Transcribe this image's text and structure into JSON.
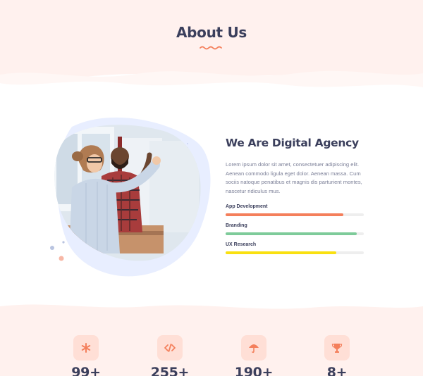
{
  "section": {
    "title": "About Us"
  },
  "about": {
    "heading": "We Are Digital Agency",
    "paragraph": "Lorem ipsum dolor sit amet, consectetuer adipiscing elit. Aenean commodo ligula eget dolor. Aenean massa. Cum sociis natoque penatibus et magnis dis parturient montes, nascetur ridiculus mus.",
    "skills": [
      {
        "label": "App Development",
        "level": 0.85,
        "color": "#f47f5b"
      },
      {
        "label": "Branding",
        "level": 0.95,
        "color": "#7ecb9a"
      },
      {
        "label": "UX Research",
        "level": 0.8,
        "color": "#f9e010"
      }
    ]
  },
  "stats": [
    {
      "icon": "asterisk-icon",
      "value": "99+"
    },
    {
      "icon": "code-icon",
      "value": "255+"
    },
    {
      "icon": "umbrella-icon",
      "value": "190+"
    },
    {
      "icon": "trophy-icon",
      "value": "8+"
    }
  ],
  "colors": {
    "accent": "#f47f5b",
    "band": "#fff1ee",
    "blob": "#e8eeff",
    "heading": "#3b3f5c",
    "body_text": "#7b7f97"
  }
}
